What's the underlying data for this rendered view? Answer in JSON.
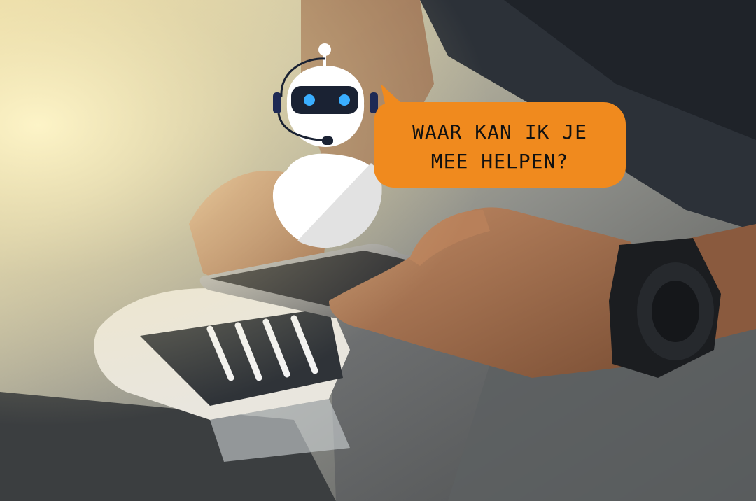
{
  "speech_bubble": {
    "line1": "WAAR KAN IK JE",
    "line2": "MEE HELPEN?"
  },
  "colors": {
    "bubble": "#F08A1E",
    "robot_face": "#1A2233",
    "robot_eyes": "#3AAEFF",
    "robot_body": "#FFFFFF",
    "headset": "#1E2A55"
  },
  "icons": [
    "chatbot-robot-icon",
    "headset-icon",
    "speech-bubble"
  ]
}
